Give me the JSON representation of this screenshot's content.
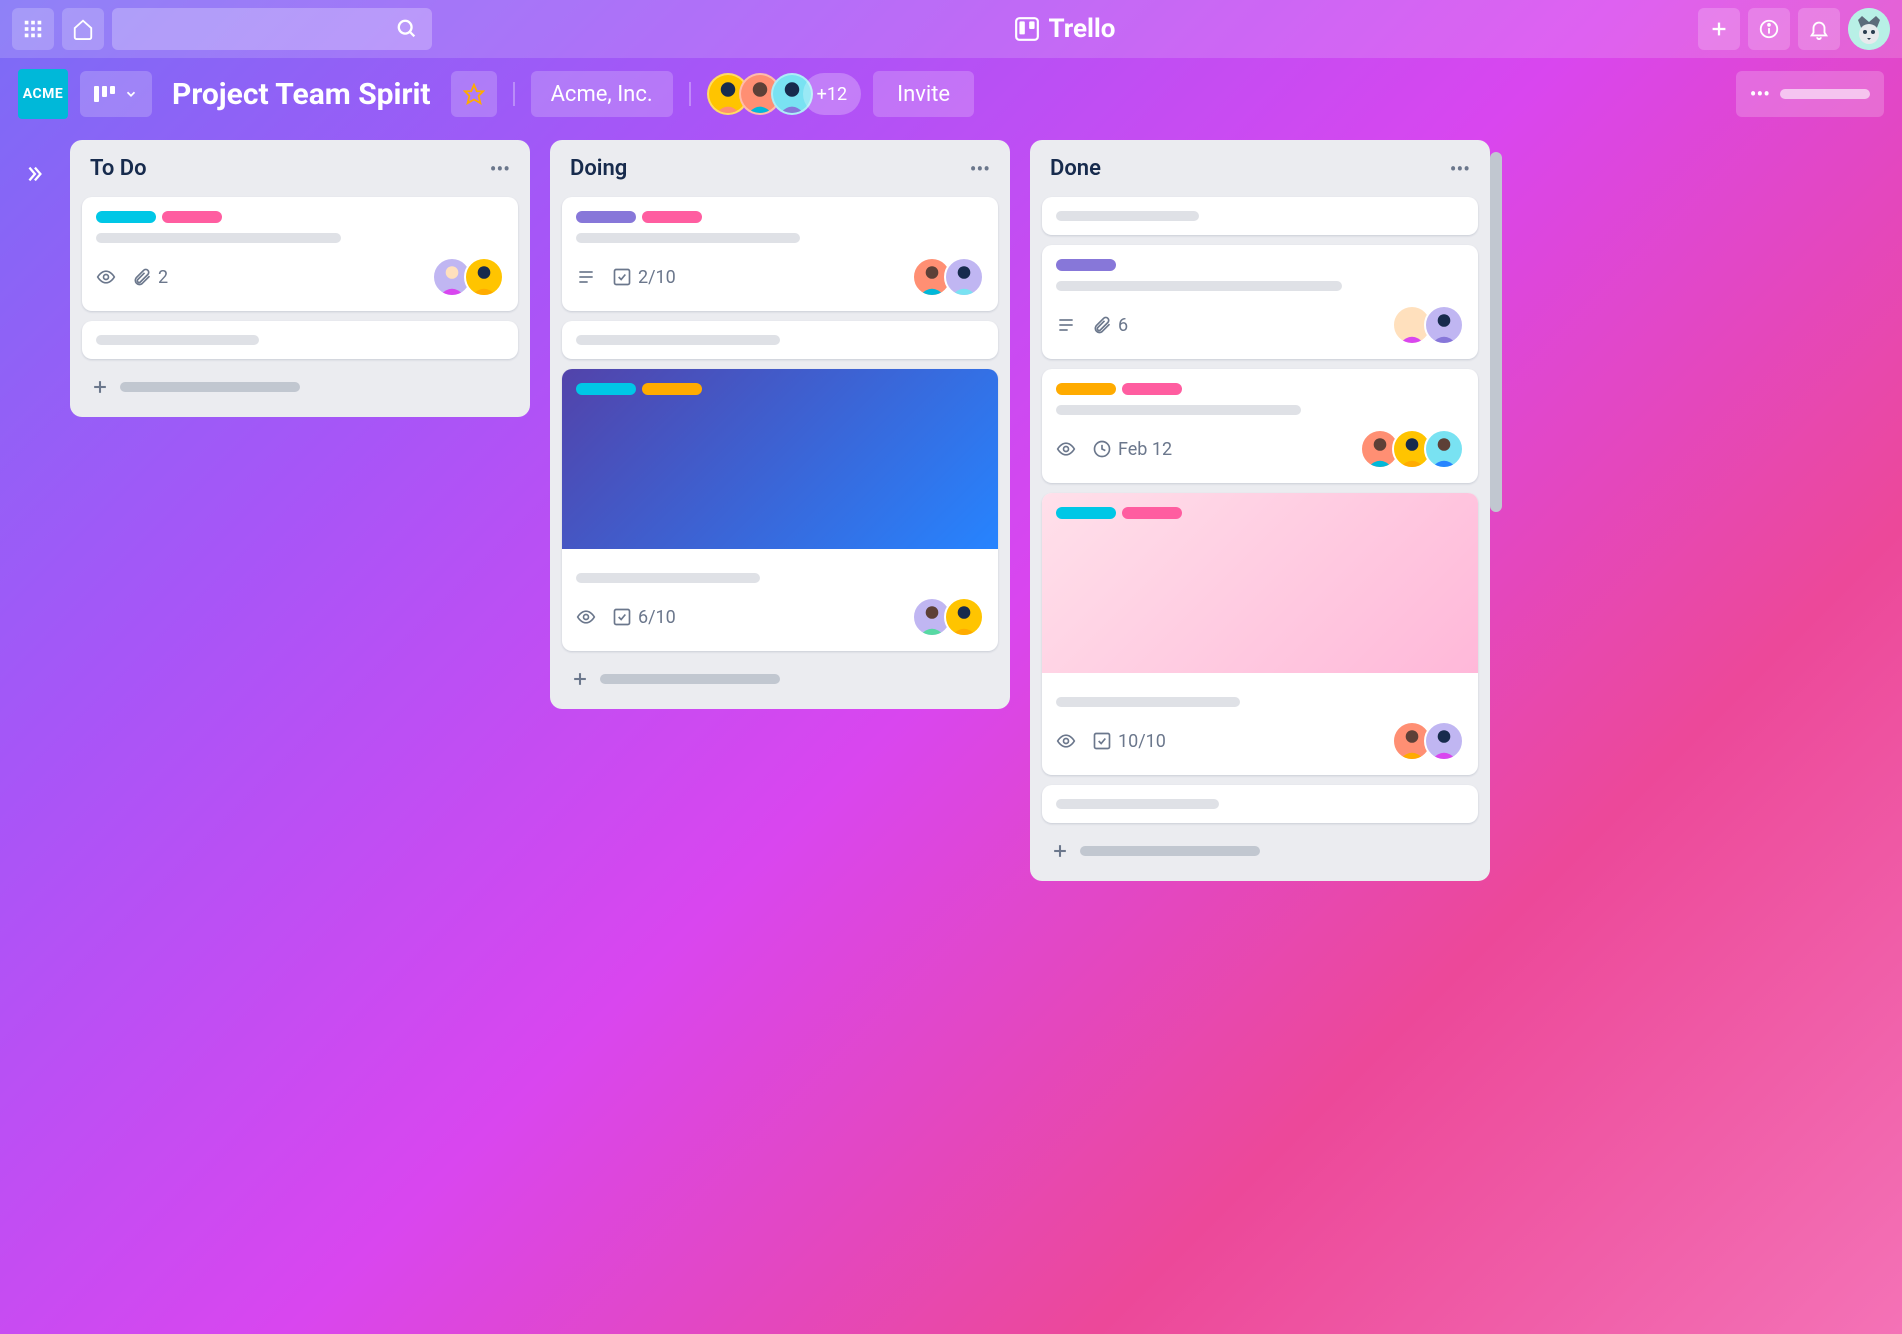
{
  "app": {
    "name": "Trello"
  },
  "board": {
    "title": "Project Team Spirit",
    "team": "Acme, Inc.",
    "team_logo": "ACME",
    "member_overflow": "+12",
    "invite_label": "Invite"
  },
  "colors": {
    "label_cyan": "#00c7e6",
    "label_pink": "#ff5da0",
    "label_purple": "#8777d9",
    "label_yellow": "#ffab00",
    "avatar_bg_1": "#c0b6f2",
    "avatar_bg_2": "#ffc400",
    "avatar_bg_3": "#ff8f73",
    "avatar_bg_4": "#79e2f2",
    "avatar_bg_5": "#57d9a3"
  },
  "lists": [
    {
      "title": "To Do",
      "cards": [
        {
          "labels": [
            "cyan",
            "pink"
          ],
          "badges": {
            "watch": true,
            "attachments": "2"
          },
          "members": 2
        },
        {
          "labels": [],
          "badges": {},
          "members": 0,
          "simple": true
        }
      ]
    },
    {
      "title": "Doing",
      "cards": [
        {
          "labels": [
            "purple",
            "pink"
          ],
          "badges": {
            "description": true,
            "checklist": "2/10"
          },
          "members": 2
        },
        {
          "labels": [],
          "badges": {},
          "members": 0,
          "simple": true
        },
        {
          "cover": "gradient-blue",
          "labels": [
            "cyan",
            "yellow"
          ],
          "badges": {
            "watch": true,
            "checklist": "6/10"
          },
          "members": 2
        }
      ]
    },
    {
      "title": "Done",
      "cards": [
        {
          "labels": [],
          "badges": {},
          "members": 0,
          "simple": true
        },
        {
          "labels": [
            "purple"
          ],
          "badges": {
            "description": true,
            "attachments": "6"
          },
          "members": 2
        },
        {
          "labels": [
            "yellow",
            "pink"
          ],
          "badges": {
            "watch": true,
            "due": "Feb 12"
          },
          "members": 3
        },
        {
          "cover": "gradient-pink",
          "labels": [
            "cyan",
            "pink"
          ],
          "badges": {
            "watch": true,
            "checklist": "10/10"
          },
          "members": 2
        },
        {
          "labels": [],
          "badges": {},
          "members": 0,
          "simple": true
        }
      ]
    }
  ]
}
